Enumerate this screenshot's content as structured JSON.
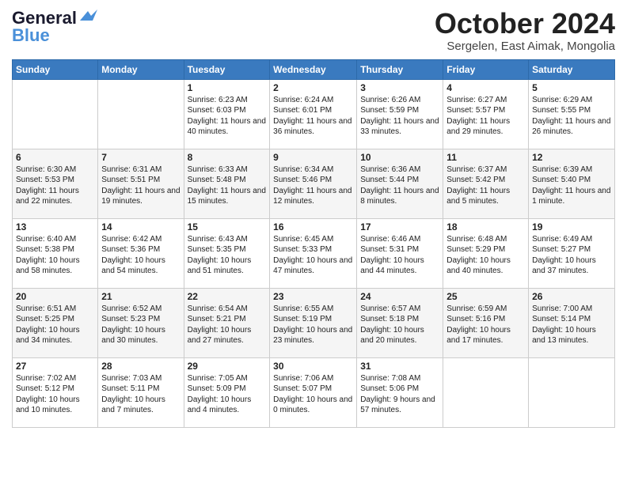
{
  "header": {
    "logo_general": "General",
    "logo_blue": "Blue",
    "month_title": "October 2024",
    "subtitle": "Sergelen, East Aimak, Mongolia"
  },
  "columns": [
    "Sunday",
    "Monday",
    "Tuesday",
    "Wednesday",
    "Thursday",
    "Friday",
    "Saturday"
  ],
  "weeks": [
    [
      {
        "day": "",
        "sunrise": "",
        "sunset": "",
        "daylight": ""
      },
      {
        "day": "",
        "sunrise": "",
        "sunset": "",
        "daylight": ""
      },
      {
        "day": "1",
        "sunrise": "Sunrise: 6:23 AM",
        "sunset": "Sunset: 6:03 PM",
        "daylight": "Daylight: 11 hours and 40 minutes."
      },
      {
        "day": "2",
        "sunrise": "Sunrise: 6:24 AM",
        "sunset": "Sunset: 6:01 PM",
        "daylight": "Daylight: 11 hours and 36 minutes."
      },
      {
        "day": "3",
        "sunrise": "Sunrise: 6:26 AM",
        "sunset": "Sunset: 5:59 PM",
        "daylight": "Daylight: 11 hours and 33 minutes."
      },
      {
        "day": "4",
        "sunrise": "Sunrise: 6:27 AM",
        "sunset": "Sunset: 5:57 PM",
        "daylight": "Daylight: 11 hours and 29 minutes."
      },
      {
        "day": "5",
        "sunrise": "Sunrise: 6:29 AM",
        "sunset": "Sunset: 5:55 PM",
        "daylight": "Daylight: 11 hours and 26 minutes."
      }
    ],
    [
      {
        "day": "6",
        "sunrise": "Sunrise: 6:30 AM",
        "sunset": "Sunset: 5:53 PM",
        "daylight": "Daylight: 11 hours and 22 minutes."
      },
      {
        "day": "7",
        "sunrise": "Sunrise: 6:31 AM",
        "sunset": "Sunset: 5:51 PM",
        "daylight": "Daylight: 11 hours and 19 minutes."
      },
      {
        "day": "8",
        "sunrise": "Sunrise: 6:33 AM",
        "sunset": "Sunset: 5:48 PM",
        "daylight": "Daylight: 11 hours and 15 minutes."
      },
      {
        "day": "9",
        "sunrise": "Sunrise: 6:34 AM",
        "sunset": "Sunset: 5:46 PM",
        "daylight": "Daylight: 11 hours and 12 minutes."
      },
      {
        "day": "10",
        "sunrise": "Sunrise: 6:36 AM",
        "sunset": "Sunset: 5:44 PM",
        "daylight": "Daylight: 11 hours and 8 minutes."
      },
      {
        "day": "11",
        "sunrise": "Sunrise: 6:37 AM",
        "sunset": "Sunset: 5:42 PM",
        "daylight": "Daylight: 11 hours and 5 minutes."
      },
      {
        "day": "12",
        "sunrise": "Sunrise: 6:39 AM",
        "sunset": "Sunset: 5:40 PM",
        "daylight": "Daylight: 11 hours and 1 minute."
      }
    ],
    [
      {
        "day": "13",
        "sunrise": "Sunrise: 6:40 AM",
        "sunset": "Sunset: 5:38 PM",
        "daylight": "Daylight: 10 hours and 58 minutes."
      },
      {
        "day": "14",
        "sunrise": "Sunrise: 6:42 AM",
        "sunset": "Sunset: 5:36 PM",
        "daylight": "Daylight: 10 hours and 54 minutes."
      },
      {
        "day": "15",
        "sunrise": "Sunrise: 6:43 AM",
        "sunset": "Sunset: 5:35 PM",
        "daylight": "Daylight: 10 hours and 51 minutes."
      },
      {
        "day": "16",
        "sunrise": "Sunrise: 6:45 AM",
        "sunset": "Sunset: 5:33 PM",
        "daylight": "Daylight: 10 hours and 47 minutes."
      },
      {
        "day": "17",
        "sunrise": "Sunrise: 6:46 AM",
        "sunset": "Sunset: 5:31 PM",
        "daylight": "Daylight: 10 hours and 44 minutes."
      },
      {
        "day": "18",
        "sunrise": "Sunrise: 6:48 AM",
        "sunset": "Sunset: 5:29 PM",
        "daylight": "Daylight: 10 hours and 40 minutes."
      },
      {
        "day": "19",
        "sunrise": "Sunrise: 6:49 AM",
        "sunset": "Sunset: 5:27 PM",
        "daylight": "Daylight: 10 hours and 37 minutes."
      }
    ],
    [
      {
        "day": "20",
        "sunrise": "Sunrise: 6:51 AM",
        "sunset": "Sunset: 5:25 PM",
        "daylight": "Daylight: 10 hours and 34 minutes."
      },
      {
        "day": "21",
        "sunrise": "Sunrise: 6:52 AM",
        "sunset": "Sunset: 5:23 PM",
        "daylight": "Daylight: 10 hours and 30 minutes."
      },
      {
        "day": "22",
        "sunrise": "Sunrise: 6:54 AM",
        "sunset": "Sunset: 5:21 PM",
        "daylight": "Daylight: 10 hours and 27 minutes."
      },
      {
        "day": "23",
        "sunrise": "Sunrise: 6:55 AM",
        "sunset": "Sunset: 5:19 PM",
        "daylight": "Daylight: 10 hours and 23 minutes."
      },
      {
        "day": "24",
        "sunrise": "Sunrise: 6:57 AM",
        "sunset": "Sunset: 5:18 PM",
        "daylight": "Daylight: 10 hours and 20 minutes."
      },
      {
        "day": "25",
        "sunrise": "Sunrise: 6:59 AM",
        "sunset": "Sunset: 5:16 PM",
        "daylight": "Daylight: 10 hours and 17 minutes."
      },
      {
        "day": "26",
        "sunrise": "Sunrise: 7:00 AM",
        "sunset": "Sunset: 5:14 PM",
        "daylight": "Daylight: 10 hours and 13 minutes."
      }
    ],
    [
      {
        "day": "27",
        "sunrise": "Sunrise: 7:02 AM",
        "sunset": "Sunset: 5:12 PM",
        "daylight": "Daylight: 10 hours and 10 minutes."
      },
      {
        "day": "28",
        "sunrise": "Sunrise: 7:03 AM",
        "sunset": "Sunset: 5:11 PM",
        "daylight": "Daylight: 10 hours and 7 minutes."
      },
      {
        "day": "29",
        "sunrise": "Sunrise: 7:05 AM",
        "sunset": "Sunset: 5:09 PM",
        "daylight": "Daylight: 10 hours and 4 minutes."
      },
      {
        "day": "30",
        "sunrise": "Sunrise: 7:06 AM",
        "sunset": "Sunset: 5:07 PM",
        "daylight": "Daylight: 10 hours and 0 minutes."
      },
      {
        "day": "31",
        "sunrise": "Sunrise: 7:08 AM",
        "sunset": "Sunset: 5:06 PM",
        "daylight": "Daylight: 9 hours and 57 minutes."
      },
      {
        "day": "",
        "sunrise": "",
        "sunset": "",
        "daylight": ""
      },
      {
        "day": "",
        "sunrise": "",
        "sunset": "",
        "daylight": ""
      }
    ]
  ]
}
